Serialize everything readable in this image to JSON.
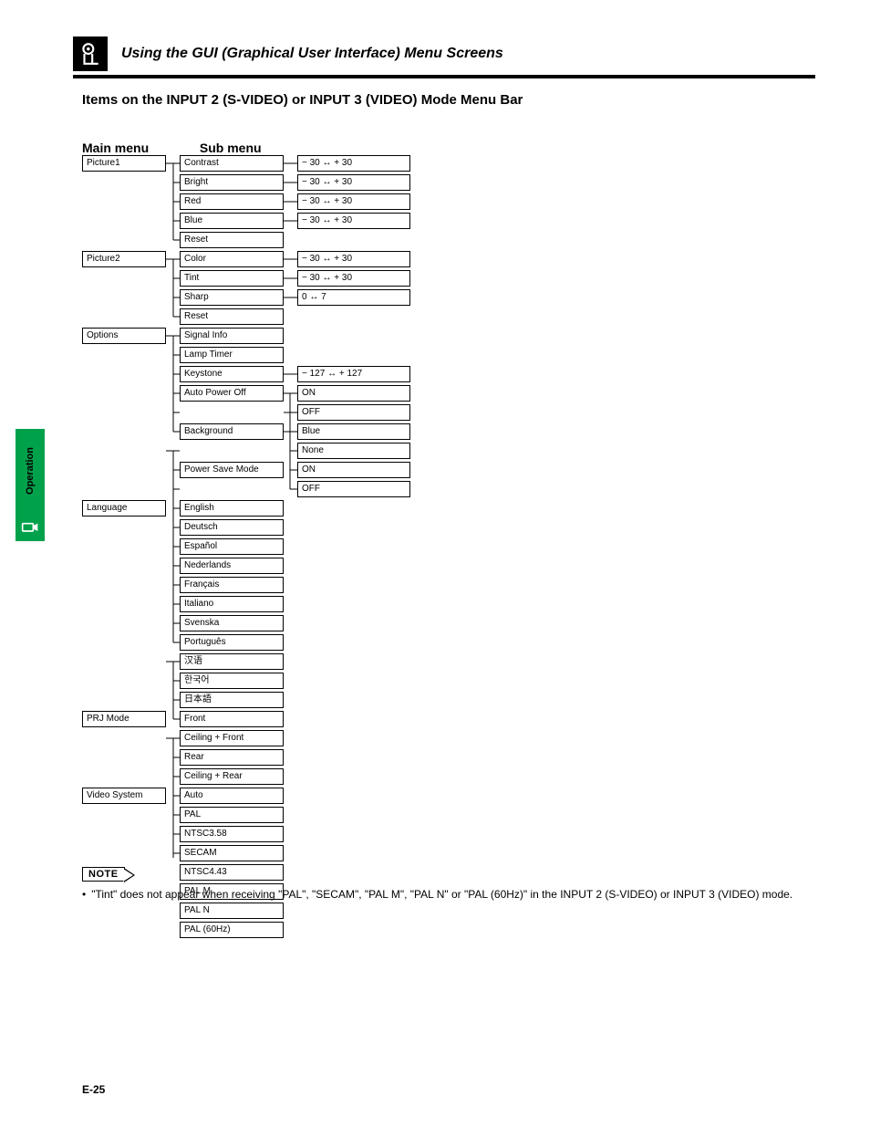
{
  "header": {
    "title": "Using the GUI (Graphical User Interface) Menu Screens",
    "icon": "projector-icon"
  },
  "side": {
    "label": "Operation",
    "icon": "operation-icon"
  },
  "subtitle": "Items on the INPUT 2 (S-VIDEO) or INPUT 3 (VIDEO) Mode Menu Bar",
  "columns": {
    "main": "Main menu",
    "sub": "Sub menu"
  },
  "menu": {
    "picture1": {
      "label": "Picture1",
      "items": {
        "contrast": {
          "label": "Contrast",
          "range": "− 30 ↔ + 30"
        },
        "bright": {
          "label": "Bright",
          "range": "− 30 ↔ + 30"
        },
        "red": {
          "label": "Red",
          "range": "− 30 ↔ + 30"
        },
        "blue": {
          "label": "Blue",
          "range": "− 30 ↔ + 30"
        },
        "reset": {
          "label": "Reset"
        }
      }
    },
    "picture2": {
      "label": "Picture2",
      "items": {
        "color": {
          "label": "Color",
          "range": "− 30 ↔ + 30"
        },
        "tint": {
          "label": "Tint",
          "range": "− 30 ↔ + 30"
        },
        "sharp": {
          "label": "Sharp",
          "range": "0 ↔ 7"
        },
        "reset": {
          "label": "Reset"
        }
      }
    },
    "options": {
      "label": "Options",
      "items": {
        "signal": {
          "label": "Signal Info"
        },
        "lamp": {
          "label": "Lamp Timer"
        },
        "keystone": {
          "label": "Keystone",
          "range": "− 127 ↔ + 127"
        },
        "autopower": {
          "label": "Auto Power Off",
          "opts": {
            "on": "ON",
            "off": "OFF"
          }
        },
        "background": {
          "label": "Background",
          "opts": {
            "blue": "Blue",
            "none": "None"
          }
        },
        "powersave": {
          "label": "Power Save Mode",
          "opts": {
            "on": "ON",
            "off": "OFF"
          }
        }
      }
    },
    "language": {
      "label": "Language",
      "items": {
        "en": "English",
        "de": "Deutsch",
        "es": "Español",
        "nl": "Nederlands",
        "fr": "Français",
        "it": "Italiano",
        "sv": "Svenska",
        "pt": "Português",
        "zh": "汉语",
        "ko": "한국어",
        "ja": "日本語"
      }
    },
    "prjmode": {
      "label": "PRJ Mode",
      "items": {
        "front": "Front",
        "ceilfront": "Ceiling + Front",
        "rear": "Rear",
        "ceilrear": "Ceiling + Rear"
      }
    },
    "videosys": {
      "label": "Video System",
      "items": {
        "auto": "Auto",
        "pal": "PAL",
        "ntsc358": "NTSC3.58",
        "secam": "SECAM",
        "ntsc443": "NTSC4.43",
        "palm": "PAL M",
        "paln": "PAL N",
        "pal60": "PAL (60Hz)"
      }
    }
  },
  "note": {
    "badge": "NOTE",
    "text": "\"Tint\" does not appear when receiving \"PAL\", \"SECAM\", \"PAL M\", \"PAL N\" or \"PAL (60Hz)\" in the INPUT 2 (S-VIDEO) or INPUT 3 (VIDEO) mode."
  },
  "page": "E-25"
}
